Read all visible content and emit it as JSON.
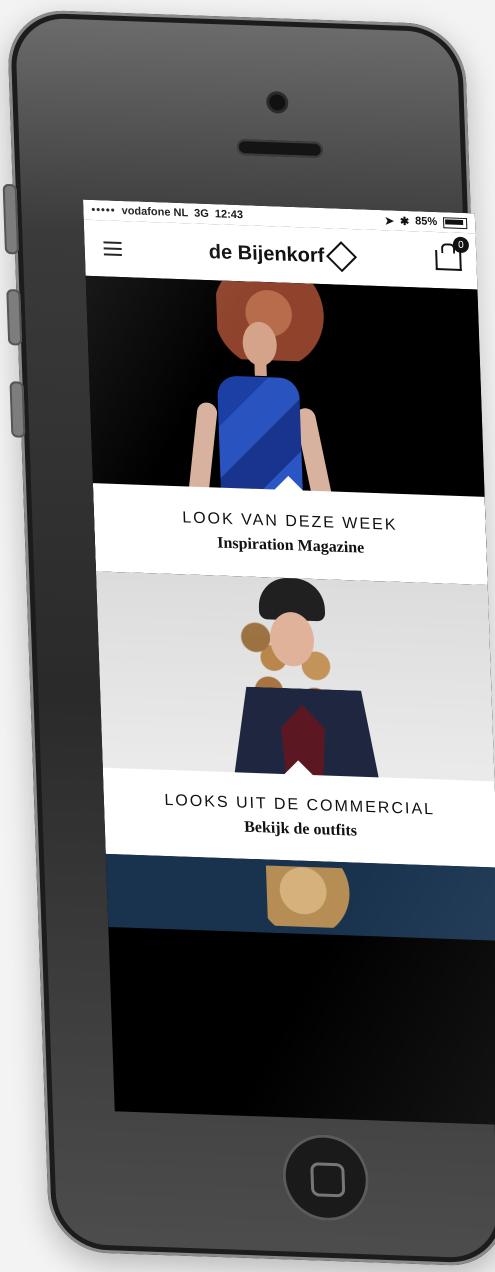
{
  "status_bar": {
    "signal": "•••••",
    "carrier": "vodafone NL",
    "network": "3G",
    "time": "12:43",
    "battery": "85%"
  },
  "header": {
    "brand": "de Bijenkorf",
    "cart_count": "0"
  },
  "features": [
    {
      "title": "LOOK VAN DEZE WEEK",
      "subtitle": "Inspiration Magazine"
    },
    {
      "title": "LOOKS UIT DE COMMERCIAL",
      "subtitle": "Bekijk de outfits"
    }
  ],
  "icons": {
    "menu": "menu-icon",
    "bag": "shopping-bag-icon",
    "logo": "bijenkorf-logo-icon",
    "battery": "battery-icon",
    "location": "location-icon",
    "bluetooth": "bluetooth-icon"
  },
  "colors": {
    "screen_bg": "#000000",
    "header_bg": "#ffffff",
    "panel_bg": "#ffffff",
    "accent_blue": "#19334f"
  }
}
